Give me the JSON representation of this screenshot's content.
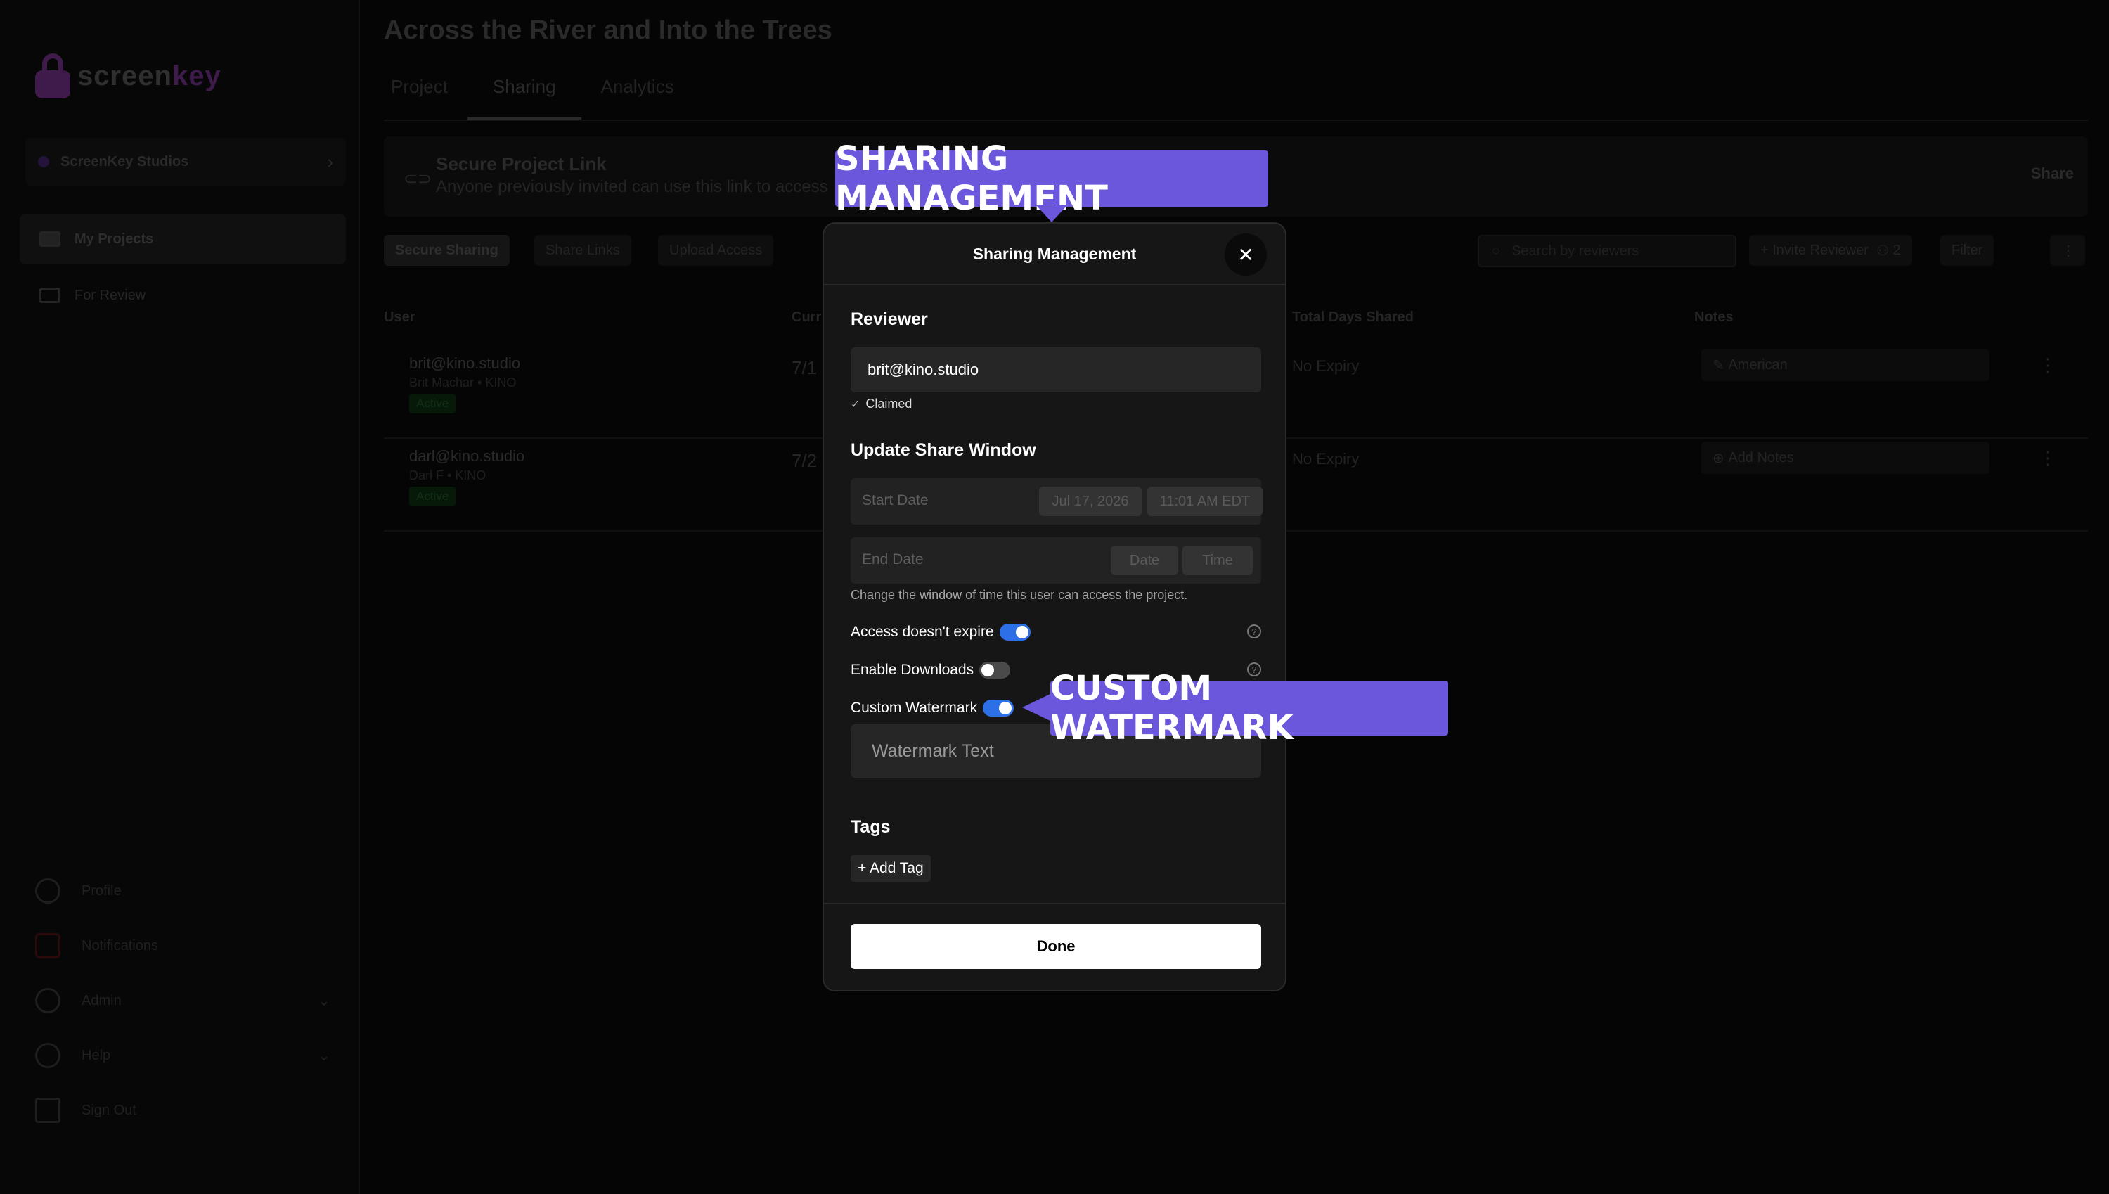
{
  "app": {
    "logo_text_a": "screen",
    "logo_text_b": "key",
    "workspace": "ScreenKey Studios",
    "nav": [
      "My Projects",
      "For Review"
    ],
    "bottom_nav": [
      "Profile",
      "Notifications",
      "Admin",
      "Help",
      "Sign Out"
    ]
  },
  "project": {
    "title": "Across the River and Into the Trees",
    "tabs": [
      "Project",
      "Sharing",
      "Analytics"
    ],
    "active_tab": "Sharing"
  },
  "link_banner": {
    "title": "Secure Project Link",
    "subtitle": "Anyone previously invited can use this link to access",
    "share_label": "Share"
  },
  "filters": {
    "chips": [
      "Secure Sharing",
      "Share Links",
      "Upload Access"
    ],
    "search_placeholder": "Search by reviewers",
    "invite_label": "+ Invite Reviewer",
    "invite_count": "2",
    "filter_label": "Filter"
  },
  "table": {
    "headers": [
      "User",
      "Curr",
      "Total Days Shared",
      "Notes"
    ],
    "rows": [
      {
        "email": "brit@kino.studio",
        "name": "Brit Machar • KINO",
        "status": "Active",
        "date": "7/1",
        "expiry": "No Expiry",
        "note": "American"
      },
      {
        "email": "darl@kino.studio",
        "name": "Darl F • KINO",
        "status": "Active",
        "date": "7/2",
        "expiry": "No Expiry",
        "note": "Add Notes"
      }
    ]
  },
  "modal": {
    "title": "Sharing Management",
    "reviewer_label": "Reviewer",
    "reviewer_email": "brit@kino.studio",
    "claimed_label": "Claimed",
    "share_window_label": "Update Share Window",
    "start_date_label": "Start Date",
    "start_date_value": "Jul 17, 2026",
    "start_time_value": "11:01 AM EDT",
    "end_date_label": "End Date",
    "end_date_btn": "Date",
    "end_time_btn": "Time",
    "help_text": "Change the window of time this user can access the project.",
    "toggles": [
      {
        "label": "Access doesn't expire",
        "on": true
      },
      {
        "label": "Enable Downloads",
        "on": false
      },
      {
        "label": "Custom Watermark",
        "on": true
      }
    ],
    "watermark_placeholder": "Watermark Text",
    "tags_label": "Tags",
    "add_tag_label": "+ Add Tag",
    "done_label": "Done"
  },
  "callouts": {
    "sharing": "SHARING MANAGEMENT",
    "watermark": "CUSTOM WATERMARK"
  },
  "colors": {
    "callout": "#6a57dc",
    "toggle_on": "#2d6fe6",
    "modal_bg": "#161616"
  }
}
